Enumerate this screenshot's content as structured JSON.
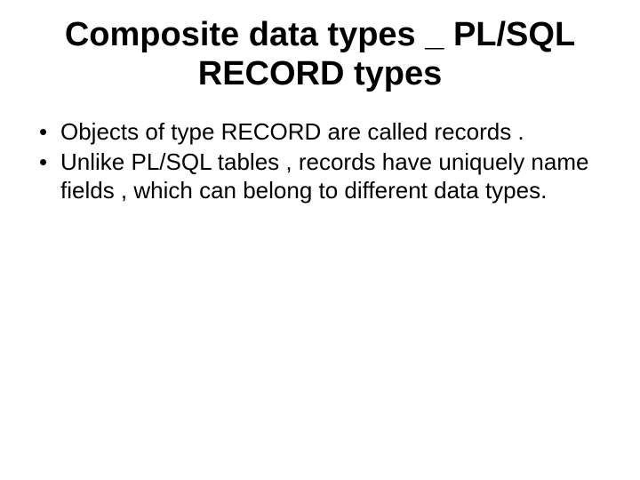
{
  "slide": {
    "title": "Composite data types _ PL/SQL RECORD types",
    "bullets": [
      "Objects of type RECORD are called records .",
      "Unlike PL/SQL tables , records have uniquely name fields , which can belong to different data types."
    ]
  }
}
